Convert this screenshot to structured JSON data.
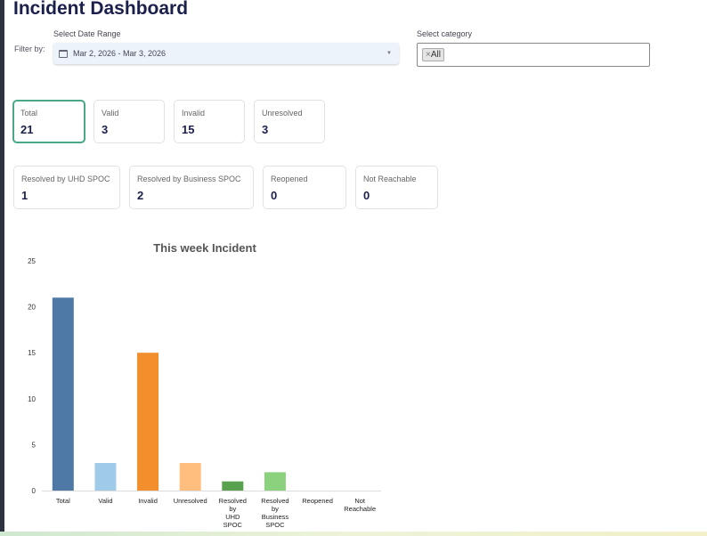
{
  "title": "Incident Dashboard",
  "filter": {
    "label": "Filter by:",
    "date_label": "Select Date Range",
    "date_value": "Mar 2, 2026 - Mar 3, 2026",
    "category_label": "Select category",
    "category_tag": "All",
    "tag_remove": "×"
  },
  "cards_row1": [
    {
      "label": "Total",
      "value": "21"
    },
    {
      "label": "Valid",
      "value": "3"
    },
    {
      "label": "Invalid",
      "value": "15"
    },
    {
      "label": "Unresolved",
      "value": "3"
    }
  ],
  "cards_row2": [
    {
      "label": "Resolved by UHD SPOC",
      "value": "1"
    },
    {
      "label": "Resolved by Business SPOC",
      "value": "2"
    },
    {
      "label": "Reopened",
      "value": "0"
    },
    {
      "label": "Not Reachable",
      "value": "0"
    }
  ],
  "chart_data": {
    "type": "bar",
    "title": "This week Incident",
    "categories": [
      "Total",
      "Valid",
      "Invalid",
      "Unresolved",
      "Resolved by UHD SPOC",
      "Resolved by Business SPOC",
      "Reopened",
      "Not Reachable"
    ],
    "values": [
      21,
      3,
      15,
      3,
      1,
      2,
      0,
      0
    ],
    "colors": [
      "#4e79a7",
      "#a0cbe8",
      "#f28e2b",
      "#ffbe7d",
      "#59a14f",
      "#8cd17d",
      "#b6992d",
      "#f1ce63"
    ],
    "ylim": [
      0,
      25
    ],
    "yticks": [
      0,
      5,
      10,
      15,
      20,
      25
    ],
    "xlabel": "",
    "ylabel": ""
  }
}
